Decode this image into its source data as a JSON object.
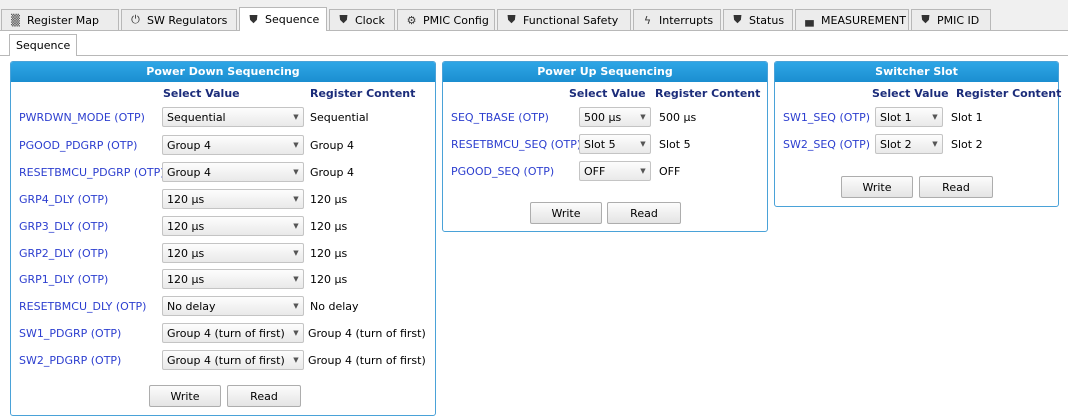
{
  "tabs": [
    {
      "label": "Register Map",
      "icon": "register-map-icon",
      "glyph": "▒"
    },
    {
      "label": "SW Regulators",
      "icon": "power-icon",
      "glyph": "⏻"
    },
    {
      "label": "Sequence",
      "icon": "shield-check-icon",
      "glyph": "⛊"
    },
    {
      "label": "Clock",
      "icon": "shield-check-icon",
      "glyph": "⛊"
    },
    {
      "label": "PMIC Config",
      "icon": "gear-icon",
      "glyph": "⚙"
    },
    {
      "label": "Functional Safety",
      "icon": "shield-check-icon",
      "glyph": "⛊"
    },
    {
      "label": "Interrupts",
      "icon": "lightning-icon",
      "glyph": "ϟ"
    },
    {
      "label": "Status",
      "icon": "shield-check-icon",
      "glyph": "⛊"
    },
    {
      "label": "MEASUREMENT",
      "icon": "measurement-icon",
      "glyph": "▄"
    },
    {
      "label": "PMIC ID",
      "icon": "shield-check-icon",
      "glyph": "⛊"
    }
  ],
  "active_tab": "Sequence",
  "sub_tab": "Sequence",
  "power_down": {
    "title": "Power Down Sequencing",
    "col_select": "Select Value",
    "col_content": "Register Content",
    "rows": [
      {
        "label": "PWRDWN_MODE (OTP)",
        "value": "Sequential",
        "content": "Sequential"
      },
      {
        "label": "PGOOD_PDGRP (OTP)",
        "value": "Group 4",
        "content": "Group 4"
      },
      {
        "label": "RESETBMCU_PDGRP (OTP)",
        "value": "Group 4",
        "content": "Group 4"
      },
      {
        "label": "GRP4_DLY (OTP)",
        "value": "120 µs",
        "content": "120 µs"
      },
      {
        "label": "GRP3_DLY (OTP)",
        "value": "120 µs",
        "content": "120 µs"
      },
      {
        "label": "GRP2_DLY (OTP)",
        "value": "120 µs",
        "content": "120 µs"
      },
      {
        "label": "GRP1_DLY (OTP)",
        "value": "120 µs",
        "content": "120 µs"
      },
      {
        "label": "RESETBMCU_DLY (OTP)",
        "value": "No delay",
        "content": "No delay"
      },
      {
        "label": "SW1_PDGRP (OTP)",
        "value": "Group 4 (turn of first)",
        "content": "Group 4 (turn of first)"
      },
      {
        "label": "SW2_PDGRP (OTP)",
        "value": "Group 4 (turn of first)",
        "content": "Group 4 (turn of first)"
      }
    ],
    "write_label": "Write",
    "read_label": "Read"
  },
  "power_up": {
    "title": "Power Up Sequencing",
    "col_select": "Select Value",
    "col_content": "Register Content",
    "rows": [
      {
        "label": "SEQ_TBASE (OTP)",
        "value": "500 µs",
        "content": "500 µs"
      },
      {
        "label": "RESETBMCU_SEQ (OTP)",
        "value": "Slot 5",
        "content": "Slot 5"
      },
      {
        "label": "PGOOD_SEQ (OTP)",
        "value": "OFF",
        "content": "OFF"
      }
    ],
    "write_label": "Write",
    "read_label": "Read"
  },
  "switcher_slot": {
    "title": "Switcher Slot",
    "col_select": "Select Value",
    "col_content": "Register Content",
    "rows": [
      {
        "label": "SW1_SEQ (OTP)",
        "value": "Slot 1",
        "content": "Slot 1"
      },
      {
        "label": "SW2_SEQ (OTP)",
        "value": "Slot 2",
        "content": "Slot 2"
      }
    ],
    "write_label": "Write",
    "read_label": "Read"
  },
  "colors": {
    "header_blue": "#1b8ed0",
    "label_blue": "#2c3ecf",
    "panel_border": "#4aa2d8"
  }
}
